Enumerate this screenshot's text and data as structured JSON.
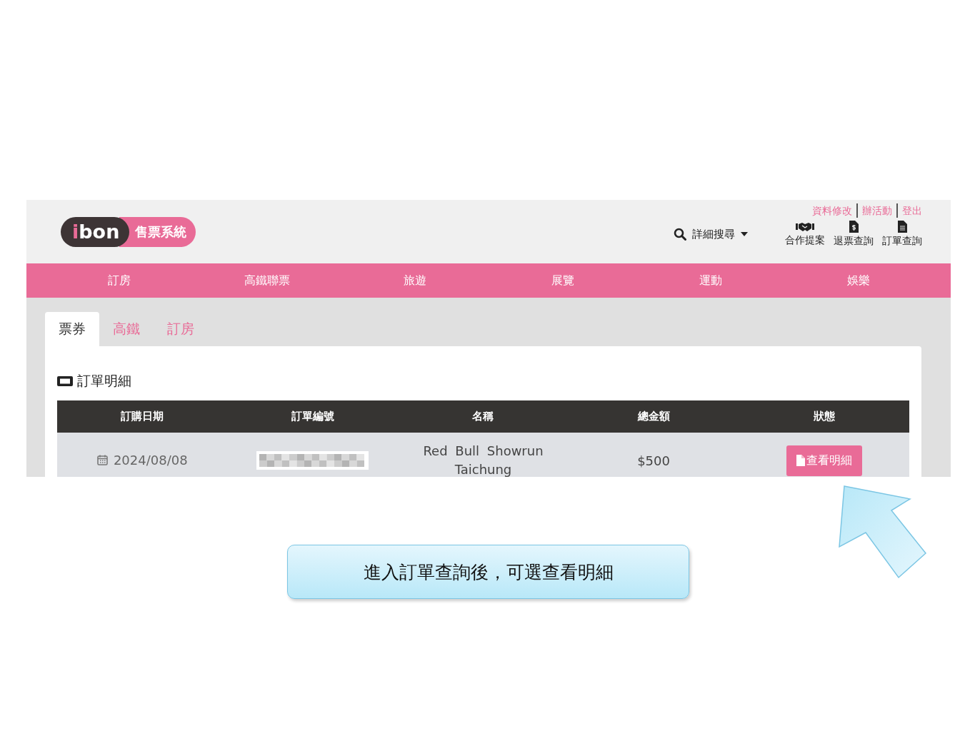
{
  "logo": {
    "brand": "ibon",
    "subtitle": "售票系統"
  },
  "user_links": [
    "資料修改",
    "辦活動",
    "登出"
  ],
  "search": {
    "label": "詳細搜尋"
  },
  "shortcuts": [
    {
      "label": "合作提案",
      "kind": "handshake"
    },
    {
      "label": "退票查詢",
      "kind": "receipt"
    },
    {
      "label": "訂單查詢",
      "kind": "document"
    }
  ],
  "nav": [
    "訂房",
    "高鐵聯票",
    "旅遊",
    "展覽",
    "運動",
    "娛樂"
  ],
  "tabs": [
    {
      "label": "票券",
      "selected": true
    },
    {
      "label": "高鐵",
      "selected": false
    },
    {
      "label": "訂房",
      "selected": false
    }
  ],
  "section_title": "訂單明細",
  "table": {
    "columns": [
      "訂購日期",
      "訂單編號",
      "名稱",
      "總金額",
      "狀態"
    ],
    "rows": [
      {
        "date": "2024/08/08",
        "order_no": {
          "kind": "redacted"
        },
        "name": "Red Bull Showrun Taichung",
        "amount": "$500",
        "action": "查看明細"
      }
    ]
  },
  "caption": "進入訂單查詢後，可選查看明細"
}
